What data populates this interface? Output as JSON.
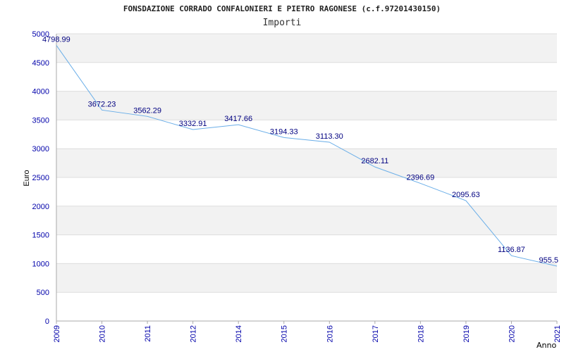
{
  "chart_data": {
    "type": "line",
    "title": "FONSDAZIONE CORRADO CONFALONIERI E PIETRO RAGONESE (c.f.97201430150)",
    "subtitle": "Importi",
    "xlabel": "Anno",
    "ylabel": "Euro",
    "ylim": [
      0,
      5000
    ],
    "yticks": [
      "0",
      "500",
      "1000",
      "1500",
      "2000",
      "2500",
      "3000",
      "3500",
      "4000",
      "4500",
      "5000"
    ],
    "grid": true,
    "categories": [
      "2009",
      "2010",
      "2011",
      "2012",
      "2014",
      "2015",
      "2016",
      "2017",
      "2018",
      "2019",
      "2020",
      "2021"
    ],
    "values": [
      4798.99,
      3672.23,
      3562.29,
      3332.91,
      3417.66,
      3194.33,
      3113.3,
      2682.11,
      2396.69,
      2095.63,
      1136.87,
      955.5
    ],
    "data_labels": [
      "4798.99",
      "3672.23",
      "3562.29",
      "3332.91",
      "3417.66",
      "3194.33",
      "3113.30",
      "2682.11",
      "2396.69",
      "2095.63",
      "1136.87",
      "955.5"
    ],
    "colors": {
      "line": "#6aaee8",
      "band": "#f2f2f2",
      "gridline": "#dddddd",
      "axis_tick_text": "#0000aa",
      "data_label": "#000080",
      "axis": "#aaaaaa"
    }
  }
}
